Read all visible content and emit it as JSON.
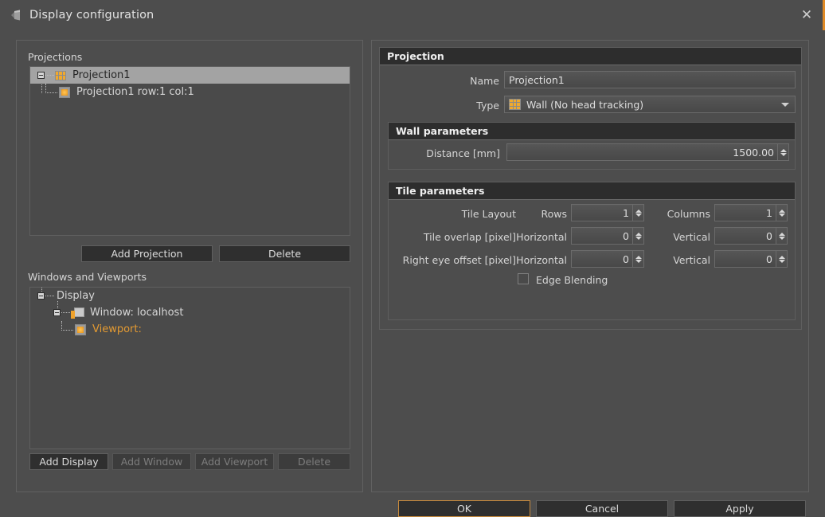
{
  "window": {
    "title": "Display configuration",
    "icon": "frustum-icon",
    "close_label": "✕",
    "accent_color": "#e08a25"
  },
  "left": {
    "projections_caption": "Projections",
    "projections_tree": [
      {
        "label": "Projection1",
        "icon": "grid-3x2-icon",
        "selected": true,
        "depth": 0
      },
      {
        "label": "Projection1 row:1 col:1",
        "icon": "tile-icon",
        "selected": false,
        "depth": 1
      }
    ],
    "projection_buttons": [
      {
        "label": "Add Projection",
        "enabled": true
      },
      {
        "label": "Delete",
        "enabled": true
      }
    ],
    "windows_caption": "Windows and Viewports",
    "windows_tree": [
      {
        "label": "Display",
        "icon": "none",
        "depth": 0,
        "orange": false
      },
      {
        "label": "Window: localhost",
        "icon": "window-icon",
        "depth": 1,
        "orange": false
      },
      {
        "label": "Viewport:",
        "icon": "tile-icon",
        "depth": 2,
        "orange": true
      }
    ],
    "window_buttons": [
      {
        "label": "Add Display",
        "enabled": true
      },
      {
        "label": "Add Window",
        "enabled": false
      },
      {
        "label": "Add Viewport",
        "enabled": false
      },
      {
        "label": "Delete",
        "enabled": false
      }
    ]
  },
  "right": {
    "projection_group": {
      "title": "Projection",
      "name_label": "Name",
      "name_value": "Projection1",
      "type_label": "Type",
      "type_value": "Wall (No head tracking)",
      "type_icon": "grid-3x3-icon"
    },
    "wall_group": {
      "title": "Wall parameters",
      "distance_label": "Distance [mm]",
      "distance_value": "1500.00"
    },
    "tile_group": {
      "title": "Tile parameters",
      "layout_label": "Tile Layout",
      "rows_label": "Rows",
      "rows_value": "1",
      "columns_label": "Columns",
      "columns_value": "1",
      "overlap_label": "Tile overlap  [pixel]",
      "overlap_h_label": "Horizontal",
      "overlap_h_value": "0",
      "overlap_v_label": "Vertical",
      "overlap_v_value": "0",
      "righteye_label": "Right eye offset [pixel]",
      "righteye_h_label": "Horizontal",
      "righteye_h_value": "0",
      "righteye_v_label": "Vertical",
      "righteye_v_value": "0",
      "edge_blending_label": "Edge Blending",
      "edge_blending_checked": false
    }
  },
  "footer": {
    "ok_label": "OK",
    "cancel_label": "Cancel",
    "apply_label": "Apply"
  }
}
